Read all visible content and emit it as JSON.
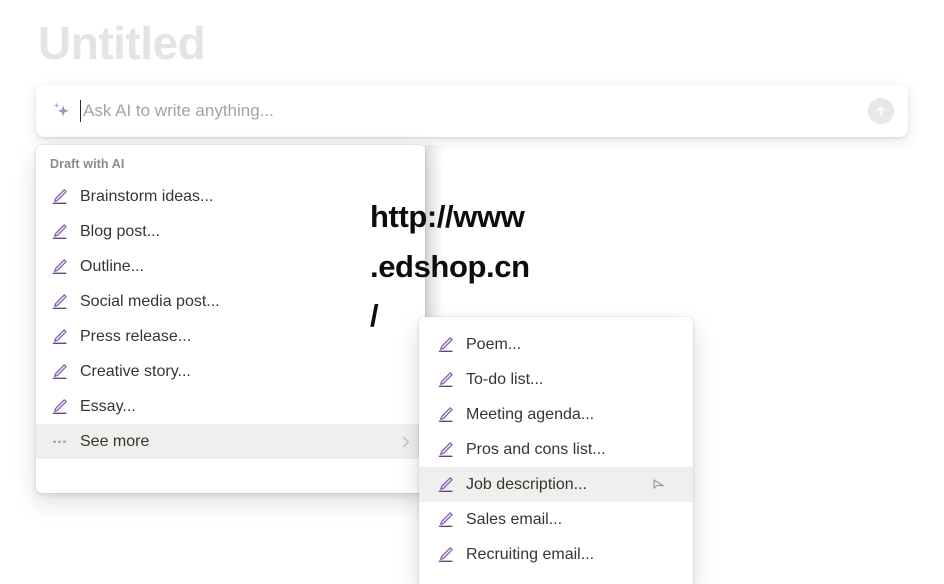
{
  "page": {
    "title": "Untitled"
  },
  "prompt": {
    "placeholder": "Ask AI to write anything...",
    "value": "",
    "sparkle_icon": "sparkle-icon",
    "submit_icon": "arrow-up-icon",
    "accent_color": "#9b87c4"
  },
  "draft_menu": {
    "section_label": "Draft with AI",
    "items": [
      {
        "label": "Brainstorm ideas...",
        "icon": "pencil-icon",
        "highlighted": false
      },
      {
        "label": "Blog post...",
        "icon": "pencil-icon",
        "highlighted": false
      },
      {
        "label": "Outline...",
        "icon": "pencil-icon",
        "highlighted": false
      },
      {
        "label": "Social media post...",
        "icon": "pencil-icon",
        "highlighted": false
      },
      {
        "label": "Press release...",
        "icon": "pencil-icon",
        "highlighted": false
      },
      {
        "label": "Creative story...",
        "icon": "pencil-icon",
        "highlighted": false
      },
      {
        "label": "Essay...",
        "icon": "pencil-icon",
        "highlighted": false
      }
    ],
    "see_more": {
      "label": "See more",
      "icon": "ellipsis-icon",
      "chevron": "chevron-right-icon",
      "highlighted": true
    }
  },
  "see_more_submenu": {
    "items": [
      {
        "label": "Poem...",
        "icon": "pencil-icon",
        "highlighted": false
      },
      {
        "label": "To-do list...",
        "icon": "pencil-icon",
        "highlighted": false
      },
      {
        "label": "Meeting agenda...",
        "icon": "pencil-icon",
        "highlighted": false
      },
      {
        "label": "Pros and cons list...",
        "icon": "pencil-icon",
        "highlighted": false
      },
      {
        "label": "Job description...",
        "icon": "pencil-icon",
        "highlighted": true,
        "cursor": "mouse-cursor-icon"
      },
      {
        "label": "Sales email...",
        "icon": "pencil-icon",
        "highlighted": false
      },
      {
        "label": "Recruiting email...",
        "icon": "pencil-icon",
        "highlighted": false
      }
    ]
  },
  "watermark": {
    "line1": "http://www",
    "line2": ".edshop.cn",
    "line3": "/"
  },
  "colors": {
    "icon_purple": "#8a63b5",
    "title_gray": "#e4e4e4",
    "text": "#37352f",
    "highlight": "#efefee"
  }
}
